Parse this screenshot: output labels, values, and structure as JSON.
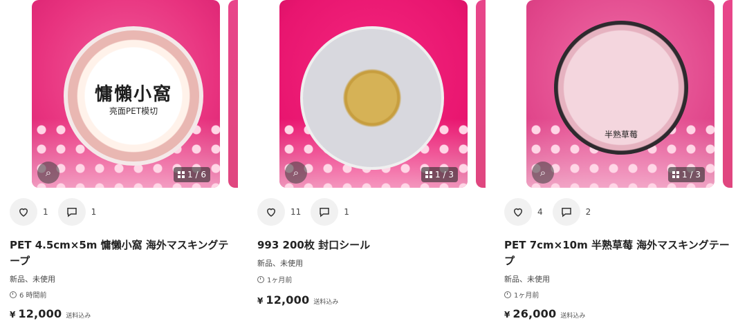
{
  "items": [
    {
      "image": {
        "tape_title": "慵懶小窩",
        "tape_sub": "亮面PET模切",
        "tape_label": "",
        "counter": "1 / 6"
      },
      "likes": "1",
      "comments": "1",
      "title": "PET 4.5cm×5m 慵懶小窩 海外マスキングテープ",
      "condition": "新品、未使用",
      "time": "6 時間前",
      "price_symbol": "¥",
      "price": "12,000",
      "shipping": "送料込み"
    },
    {
      "image": {
        "tape_title": "",
        "tape_sub": "",
        "tape_label": "",
        "counter": "1 / 3"
      },
      "likes": "11",
      "comments": "1",
      "title": "993 200枚 封口シール",
      "condition": "新品、未使用",
      "time": "1ヶ月前",
      "price_symbol": "¥",
      "price": "12,000",
      "shipping": "送料込み"
    },
    {
      "image": {
        "tape_title": "",
        "tape_sub": "",
        "tape_label": "半熟草莓",
        "counter": "1 / 3"
      },
      "likes": "4",
      "comments": "2",
      "title": "PET 7cm×10m 半熟草莓 海外マスキングテープ",
      "condition": "新品、未使用",
      "time": "1ヶ月前",
      "price_symbol": "¥",
      "price": "26,000",
      "shipping": "送料込み"
    }
  ],
  "icons": {
    "like": "heart-icon",
    "comment": "comment-icon",
    "zoom": "image-search-icon",
    "gallery": "grid-icon",
    "time": "clock-icon"
  },
  "colors": {
    "accent_pink": "#e8337f"
  }
}
